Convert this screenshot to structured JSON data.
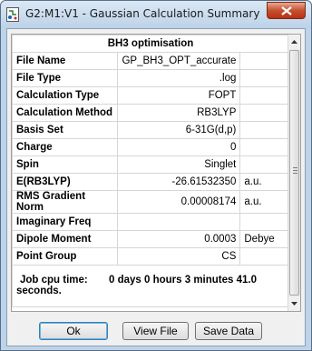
{
  "window": {
    "title": "G2:M1:V1 - Gaussian Calculation Summary"
  },
  "table": {
    "header": "BH3 optimisation",
    "rows": [
      {
        "label": "File Name",
        "value": "GP_BH3_OPT_accurate",
        "unit": ""
      },
      {
        "label": "File Type",
        "value": ".log",
        "unit": ""
      },
      {
        "label": "Calculation Type",
        "value": "FOPT",
        "unit": ""
      },
      {
        "label": "Calculation Method",
        "value": "RB3LYP",
        "unit": ""
      },
      {
        "label": "Basis Set",
        "value": "6-31G(d,p)",
        "unit": ""
      },
      {
        "label": "Charge",
        "value": "0",
        "unit": ""
      },
      {
        "label": "Spin",
        "value": "Singlet",
        "unit": ""
      },
      {
        "label": "E(RB3LYP)",
        "value": "-26.61532350",
        "unit": "a.u."
      },
      {
        "label": "RMS Gradient Norm",
        "value": "0.00008174",
        "unit": "a.u."
      },
      {
        "label": "Imaginary Freq",
        "value": "",
        "unit": ""
      },
      {
        "label": "Dipole Moment",
        "value": "0.0003",
        "unit": "Debye"
      },
      {
        "label": "Point Group",
        "value": "CS",
        "unit": ""
      }
    ],
    "job_cpu_label": "Job cpu time:",
    "job_cpu_value": "0 days  0 hours  3 minutes 41.0 seconds."
  },
  "buttons": {
    "ok": "Ok",
    "view_file": "View File",
    "save_data": "Save Data"
  }
}
